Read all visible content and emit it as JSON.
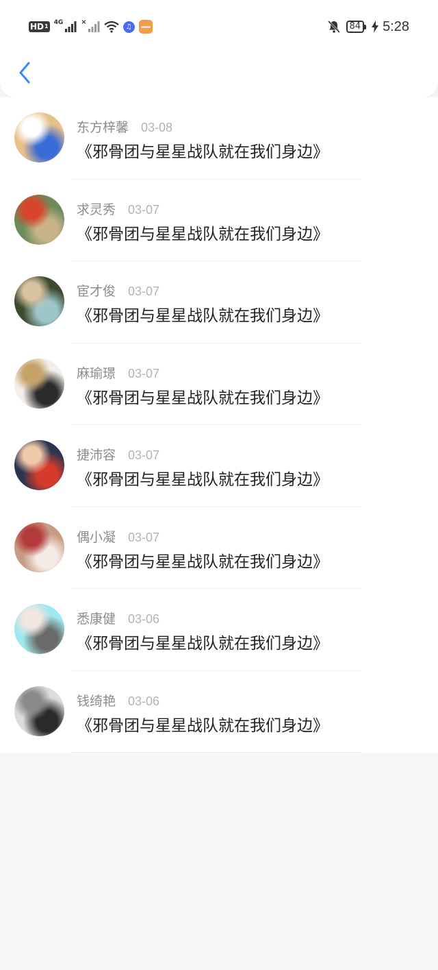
{
  "status_bar": {
    "hd_label": "HD",
    "hd_sub": "1",
    "network_label": "4G",
    "x_label": "×",
    "music_glyph": "♫",
    "battery_level": "84",
    "time": "5:28"
  },
  "header": {
    "back_icon": "chevron-left-icon",
    "accent_color": "#2f8ff0"
  },
  "comments": [
    {
      "name": "东方梓馨",
      "date": "03-08",
      "title": "《邪骨团与星星战队就在我们身边》",
      "avatar_colors": [
        "#e9c08a",
        "#3b6bd6",
        "#ffffff"
      ]
    },
    {
      "name": "求灵秀",
      "date": "03-07",
      "title": "《邪骨团与星星战队就在我们身边》",
      "avatar_colors": [
        "#6d8a5a",
        "#c9b48a",
        "#d9452c"
      ]
    },
    {
      "name": "宦才俊",
      "date": "03-07",
      "title": "《邪骨团与星星战队就在我们身边》",
      "avatar_colors": [
        "#3e4a2e",
        "#9cc6c9",
        "#d8c3a0"
      ]
    },
    {
      "name": "麻瑜璟",
      "date": "03-07",
      "title": "《邪骨团与星星战队就在我们身边》",
      "avatar_colors": [
        "#f2efe9",
        "#2b2b2b",
        "#c7a36a"
      ]
    },
    {
      "name": "捷沛容",
      "date": "03-07",
      "title": "《邪骨团与星星战队就在我们身边》",
      "avatar_colors": [
        "#2c3550",
        "#d43b2c",
        "#f0c9a8"
      ]
    },
    {
      "name": "偶小凝",
      "date": "03-07",
      "title": "《邪骨团与星星战队就在我们身边》",
      "avatar_colors": [
        "#c89c82",
        "#f4ebe6",
        "#b23a3a"
      ]
    },
    {
      "name": "悉康健",
      "date": "03-06",
      "title": "《邪骨团与星星战队就在我们身边》",
      "avatar_colors": [
        "#9fe8ee",
        "#6a6a6a",
        "#f1e6e0"
      ]
    },
    {
      "name": "钱绮艳",
      "date": "03-06",
      "title": "《邪骨团与星星战队就在我们身边》",
      "avatar_colors": [
        "#dcdcdc",
        "#2a2a2a",
        "#8a8a8a"
      ]
    }
  ]
}
